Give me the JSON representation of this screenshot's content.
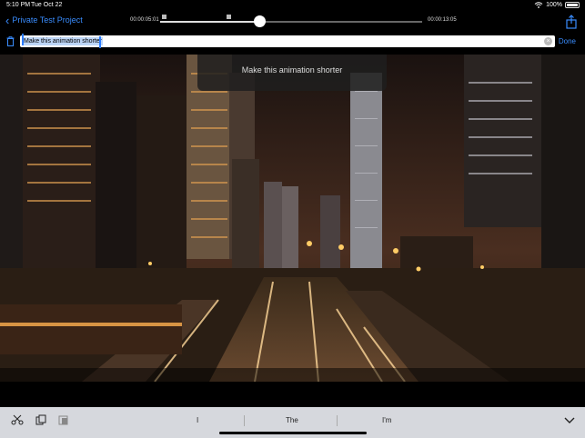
{
  "status_bar": {
    "time": "5:10 PM",
    "date": "Tue Oct 22",
    "battery_text": "100%",
    "battery_level": 1.0
  },
  "top_bar": {
    "back_label": "Private Test Project",
    "start_time": "00:00:05:01",
    "end_time": "00:00:13:05",
    "scrub_progress": 0.38
  },
  "edit_row": {
    "text_value": "Make this animation shorter",
    "done_label": "Done"
  },
  "caption": {
    "text": "Make this animation shorter"
  },
  "keyboard": {
    "suggestions": [
      "I",
      "The",
      "I'm"
    ]
  },
  "icons": {
    "back": "chevron-left-icon",
    "share": "share-icon",
    "trash": "trash-icon",
    "clear": "clear-icon",
    "cut": "scissors-icon",
    "copy": "copy-icon",
    "paste": "paste-icon",
    "dismiss": "chevron-down-icon"
  },
  "colors": {
    "accent": "#3a8dff",
    "selection": "#bcd5f7"
  }
}
